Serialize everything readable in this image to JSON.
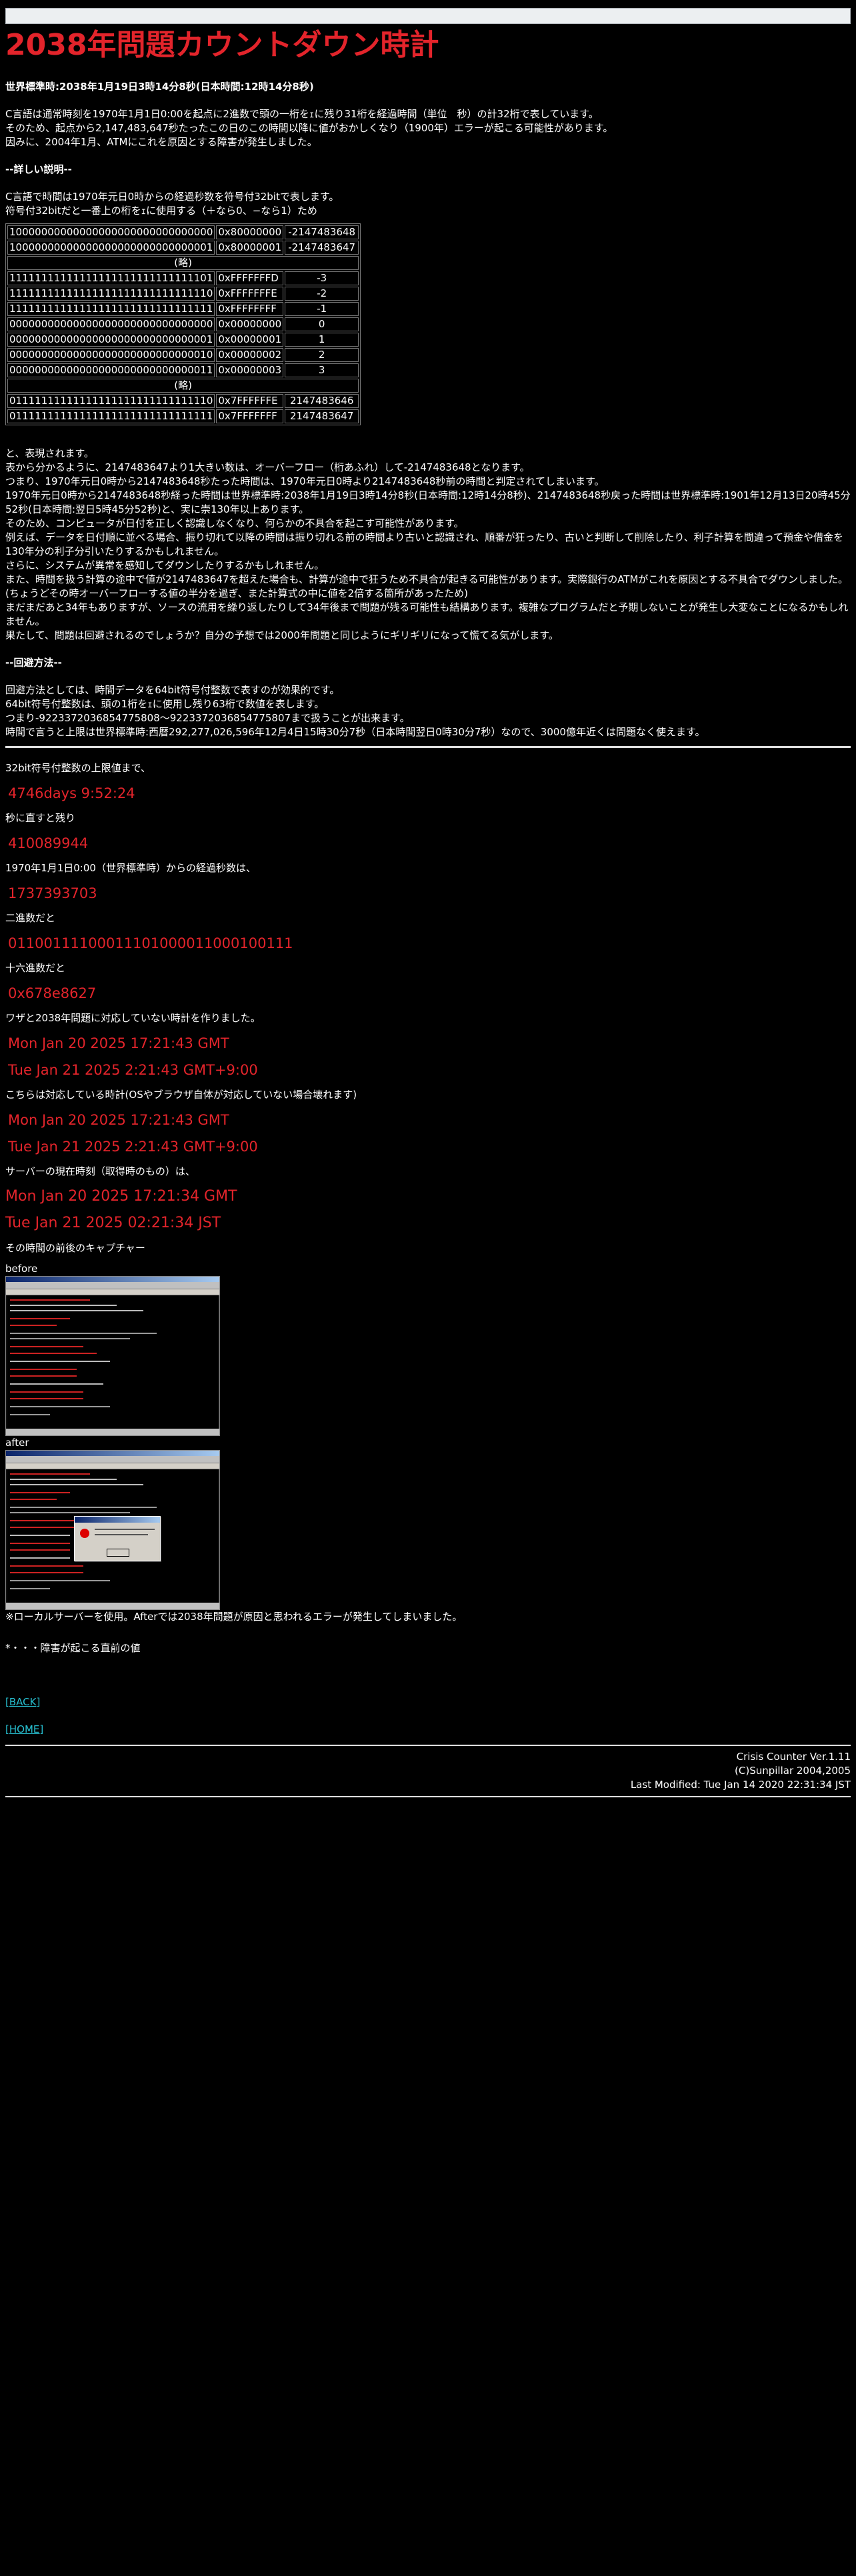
{
  "header": {
    "title": "2038年問題カウントダウン時計",
    "utc_time": "世界標準時:2038年1月19日3時14分8秒(日本時間:12時14分8秒)"
  },
  "intro": [
    "C言語は通常時刻を1970年1月1日0:00を起点に2進数で頭の一桁をｪに残り31桁を経過時間（単位　秒）の計32桁で表しています。",
    "そのため、起点から2,147,483,647秒たったこの日のこの時間以降に値がおかしくなり（1900年）エラーが起こる可能性があります。",
    "因みに、2004年1月、ATMにこれを原因とする障害が発生しました。"
  ],
  "details": {
    "heading": "--詳しい説明--",
    "lines": [
      "C言語で時間は1970年元日0時からの経過秒数を符号付32bitで表します。",
      "符号付32bitだと一番上の桁をｪに使用する（＋なら0、−なら1）ため"
    ]
  },
  "bits_table": {
    "skip_label": "(略)",
    "top_rows": [
      [
        "10000000000000000000000000000000",
        "0x80000000",
        "-2147483648"
      ],
      [
        "10000000000000000000000000000001",
        "0x80000001",
        "-2147483647"
      ]
    ],
    "middle_rows": [
      [
        "11111111111111111111111111111101",
        "0xFFFFFFFD",
        "-3"
      ],
      [
        "11111111111111111111111111111110",
        "0xFFFFFFFE",
        "-2"
      ],
      [
        "11111111111111111111111111111111",
        "0xFFFFFFFF",
        "-1"
      ],
      [
        "00000000000000000000000000000000",
        "0x00000000",
        "0"
      ],
      [
        "00000000000000000000000000000001",
        "0x00000001",
        "1"
      ],
      [
        "00000000000000000000000000000010",
        "0x00000002",
        "2"
      ],
      [
        "00000000000000000000000000000011",
        "0x00000003",
        "3"
      ]
    ],
    "bottom_rows": [
      [
        "01111111111111111111111111111110",
        "0x7FFFFFFE",
        "2147483646"
      ],
      [
        "01111111111111111111111111111111",
        "0x7FFFFFFF",
        "2147483647"
      ]
    ]
  },
  "explanation": [
    "と、表現されます。",
    "表から分かるように、2147483647より1大きい数は、オーバーフロー（桁あふれ）して-2147483648となります。",
    "つまり、1970年元日0時から2147483648秒たった時間は、1970年元日0時より2147483648秒前の時間と判定されてしまいます。",
    "1970年元日0時から2147483648秒経った時間は世界標準時:2038年1月19日3時14分8秒(日本時間:12時14分8秒)、2147483648秒戻った時間は世界標準時:1901年12月13日20時45分52秒(日本時間:翌日5時45分52秒)と、実に崇130年以上あります。",
    "そのため、コンピュータが日付を正しく認識しなくなり、何らかの不具合を起こす可能性があります。",
    "例えば、データを日付順に並べる場合、振り切れて以降の時間は振り切れる前の時間より古いと認識され、順番が狂ったり、古いと判断して削除したり、利子計算を間違って預金や借金を130年分の利子分引いたりするかもしれません。",
    "さらに、システムが異常を感知してダウンしたりするかもしれません。",
    "また、時間を扱う計算の途中で値が2147483647を超えた場合も、計算が途中で狂うため不具合が起きる可能性があります。実際銀行のATMがこれを原因とする不具合でダウンしました。(ちょうどその時オーバーフローする値の半分を過ぎ、また計算式の中に値を2倍する箇所があったため)",
    "まだまだあと34年もありますが、ソースの流用を繰り返したりして34年後まで問題が残る可能性も結構あります。複雑なプログラムだと予期しないことが発生し大変なことになるかもしれません。",
    "果たして、問題は回避されるのでしょうか？自分の予想では2000年問題と同じようにギリギリになって慌てる気がします。"
  ],
  "workaround": {
    "heading": "--回避方法--",
    "lines": [
      "回避方法としては、時間データを64bit符号付整数で表すのが効果的です。",
      "64bit符号付整数は、頭の1桁をｪに使用し残り63桁で数値を表します。",
      "つまり-9223372036854775808〜9223372036854775807まで扱うことが出来ます。",
      "時間で言うと上限は世界標準時:西暦292,277,026,596年12月4日15時30分7秒（日本時間翌日0時30分7秒）なので、3000億年近くは問題なく使えます。"
    ]
  },
  "counter": {
    "remaining_label": "32bit符号付整数の上限値まで、",
    "remaining_value": "4746days 9:52:24",
    "seconds_label": "秒に直すと残り",
    "seconds_value": "410089944",
    "elapsed_label": "1970年1月1日0:00（世界標準時）からの経過秒数は、",
    "elapsed_value": "1737393703",
    "binary_label": "二進数だと",
    "binary_value": "01100111100011101000011000100111",
    "hex_label": "十六進数だと",
    "hex_value": "0x678e8627",
    "clock_label": "ワザと2038年問題に対応していない時計を作りました。",
    "clock_gmt": "Mon Jan 20 2025 17:21:43 GMT",
    "clock_local": "Tue Jan 21 2025 2:21:43 GMT+9:00",
    "compliant_label": "こちらは対応している時計(OSやブラウザ自体が対応していない場合壊れます)",
    "compliant_gmt": "Mon Jan 20 2025 17:21:43 GMT",
    "compliant_local": "Tue Jan 21 2025 2:21:43 GMT+9:00",
    "server_label": "サーバーの現在時刻（取得時のもの）は、",
    "server_gmt": "Mon Jan 20 2025 17:21:34 GMT",
    "server_jst": "Tue Jan 21 2025 02:21:34 JST",
    "capture_label": "その時間の前後のキャプチャー",
    "before_label": "before",
    "after_label": "after",
    "note": "※ローカルサーバーを使用。Afterでは2038年問題が原因と思われるエラーが発生してしまいました。",
    "footnote": "*・・・障害が起こる直前の値"
  },
  "nav": {
    "back": "[BACK]",
    "home": "[HOME]"
  },
  "footer": {
    "counter": "Crisis Counter Ver.1.11",
    "copyright": "(C)Sunpillar 2004,2005",
    "modified": "Last Modified: Tue Jan 14 2020 22:31:34 JST"
  }
}
